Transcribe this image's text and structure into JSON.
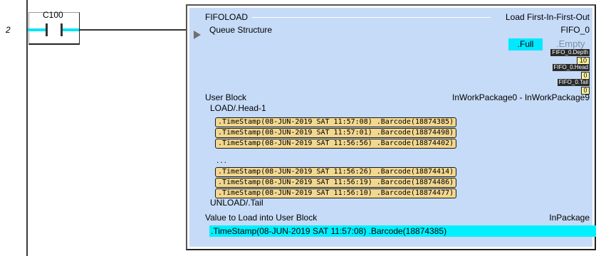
{
  "rung": {
    "number": "2"
  },
  "contact": {
    "tag": "C100"
  },
  "instruction": {
    "mnemonic": "FIFOLOAD",
    "description": "Load First-In-First-Out",
    "queue_label": "Queue Structure",
    "queue_tag": "FIFO_0",
    "full_label": ".Full",
    "empty_label": ".Empty",
    "depth": {
      "label": "FIFO_0.Depth",
      "value": "10"
    },
    "head": {
      "label": "FIFO_0.Head",
      "value": "0"
    },
    "tail": {
      "label": "FIFO_0.Tail",
      "value": "0"
    },
    "user_block_label": "User Block",
    "user_block_range": "InWorkPackage0 - InWorkPackage9",
    "head_label": "LOAD/.Head-1",
    "rows_top": [
      ".TimeStamp(08-JUN-2019 SAT 11:57:08)  .Barcode(18874385)",
      ".TimeStamp(08-JUN-2019 SAT 11:57:01)  .Barcode(18874498)",
      ".TimeStamp(08-JUN-2019 SAT 11:56:56)  .Barcode(18874402)"
    ],
    "ellipsis": "...",
    "rows_bottom": [
      ".TimeStamp(08-JUN-2019 SAT 11:56:26)  .Barcode(18874414)",
      ".TimeStamp(08-JUN-2019 SAT 11:56:19)  .Barcode(18874486)",
      ".TimeStamp(08-JUN-2019 SAT 11:56:10)  .Barcode(18874477)"
    ],
    "tail_label": "UNLOAD/.Tail",
    "value_label": "Value to Load into User Block",
    "value_tag": "InPackage",
    "value": ".TimeStamp(08-JUN-2019 SAT 11:57:08)  .Barcode(18874385)"
  },
  "colors": {
    "instruction_bg": "#c6dbf7",
    "highlight_cyan": "#00e8ff",
    "row_fill": "#f2d78e"
  }
}
